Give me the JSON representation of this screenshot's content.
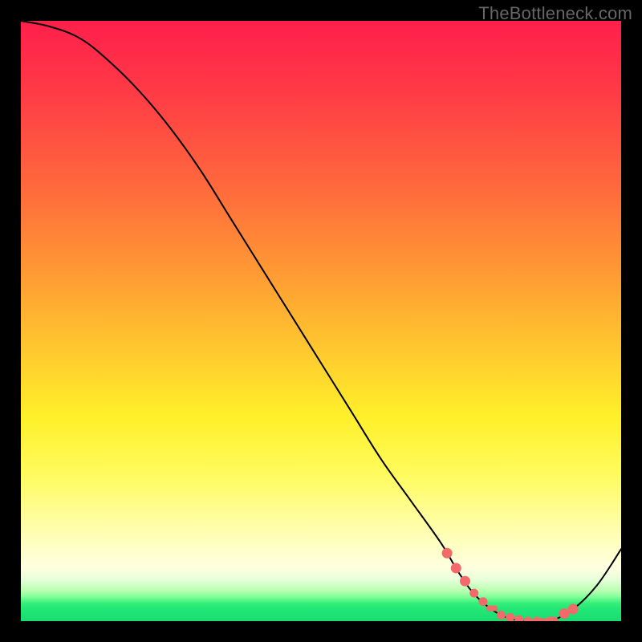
{
  "watermark": "TheBottleneck.com",
  "colors": {
    "background": "#000000",
    "curve": "#000000",
    "marker": "#f26a6a",
    "gradient_top": "#ff1f4b",
    "gradient_mid": "#fff02a",
    "gradient_bottom": "#18dc6e"
  },
  "chart_data": {
    "type": "line",
    "title": "",
    "xlabel": "",
    "ylabel": "",
    "xlim": [
      0,
      100
    ],
    "ylim": [
      0,
      100
    ],
    "grid": false,
    "legend_position": "none",
    "series": [
      {
        "name": "bottleneck-curve",
        "x": [
          0,
          5,
          10,
          15,
          20,
          25,
          30,
          35,
          40,
          45,
          50,
          55,
          60,
          65,
          70,
          73,
          76,
          80,
          84,
          88,
          92,
          96,
          100
        ],
        "values": [
          100,
          99,
          97,
          93,
          88,
          82,
          75,
          67,
          59,
          51,
          43,
          35,
          27,
          20,
          13,
          8,
          4,
          1,
          0,
          0,
          2,
          6,
          12
        ]
      }
    ],
    "markers": {
      "name": "highlight-points",
      "along_curve_x": [
        71,
        72.5,
        74,
        75.5,
        77,
        80,
        81.5,
        83,
        84.5,
        86,
        90.5,
        92
      ],
      "dashes_x": [
        78.5,
        87,
        88.5
      ]
    }
  }
}
